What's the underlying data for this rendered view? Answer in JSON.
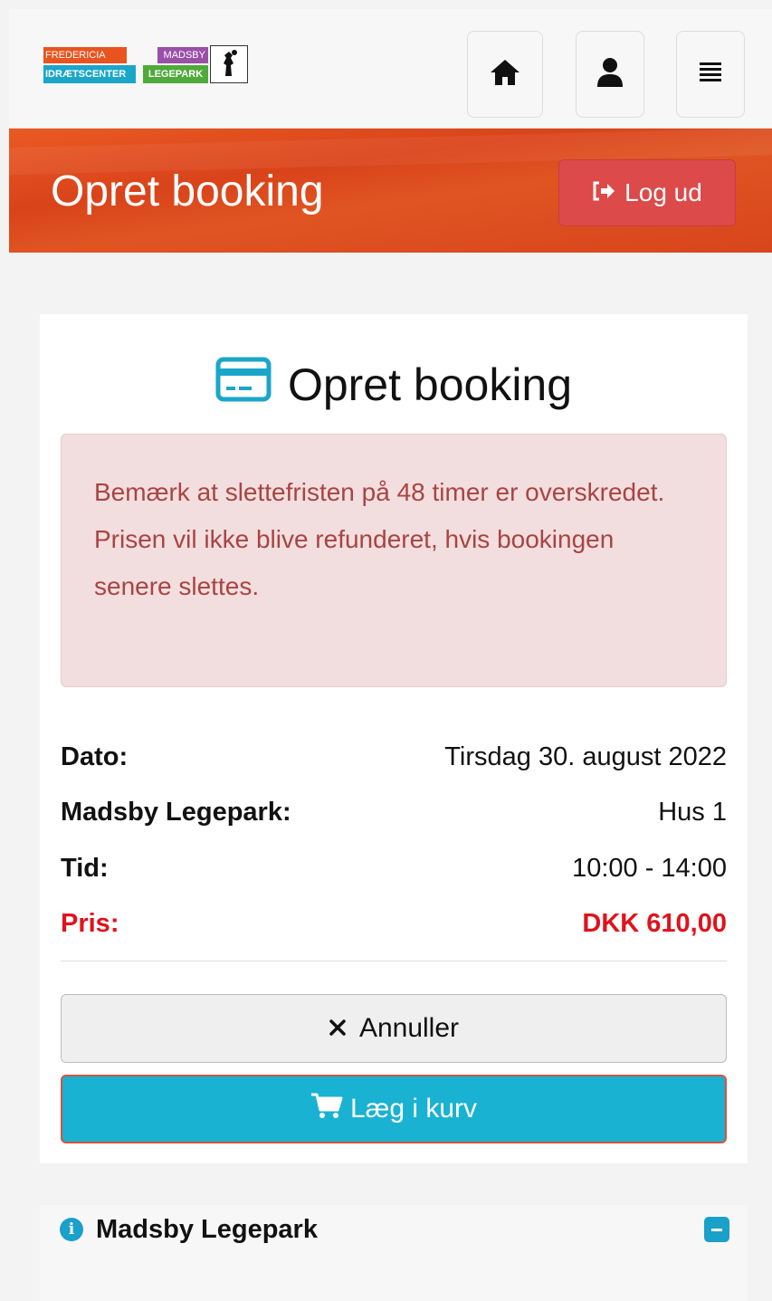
{
  "header": {
    "logo": {
      "line1_left": "FREDERICIA",
      "line2_left": "IDRÆTSCENTER",
      "line1_right": "MADSBY",
      "line2_right": "LEGEPARK"
    },
    "nav_icons": [
      "home-icon",
      "user-icon",
      "menu-icon"
    ]
  },
  "banner": {
    "title": "Opret booking",
    "logout_label": "Log ud"
  },
  "booking": {
    "title": "Opret booking",
    "alert": {
      "line1": "Bemærk at slettefristen på 48 timer er overskredet.",
      "line2": "Prisen vil ikke blive refunderet, hvis bookingen senere slettes."
    },
    "details": [
      {
        "label": "Dato:",
        "value": "Tirsdag 30. august 2022"
      },
      {
        "label": "Madsby Legepark:",
        "value": "Hus 1"
      },
      {
        "label": "Tid:",
        "value": "10:00 - 14:00"
      },
      {
        "label": "Pris:",
        "value": "DKK 610,00"
      }
    ],
    "cancel_label": "Annuller",
    "cart_label": "Læg i kurv"
  },
  "info": {
    "title": "Madsby Legepark"
  },
  "colors": {
    "accent_orange": "#e0501f",
    "logout_red": "#dc4a4a",
    "cart_blue": "#1ab2d2",
    "price_red": "#e0121b",
    "alert_bg": "#f2dede",
    "alert_text": "#a94442"
  }
}
